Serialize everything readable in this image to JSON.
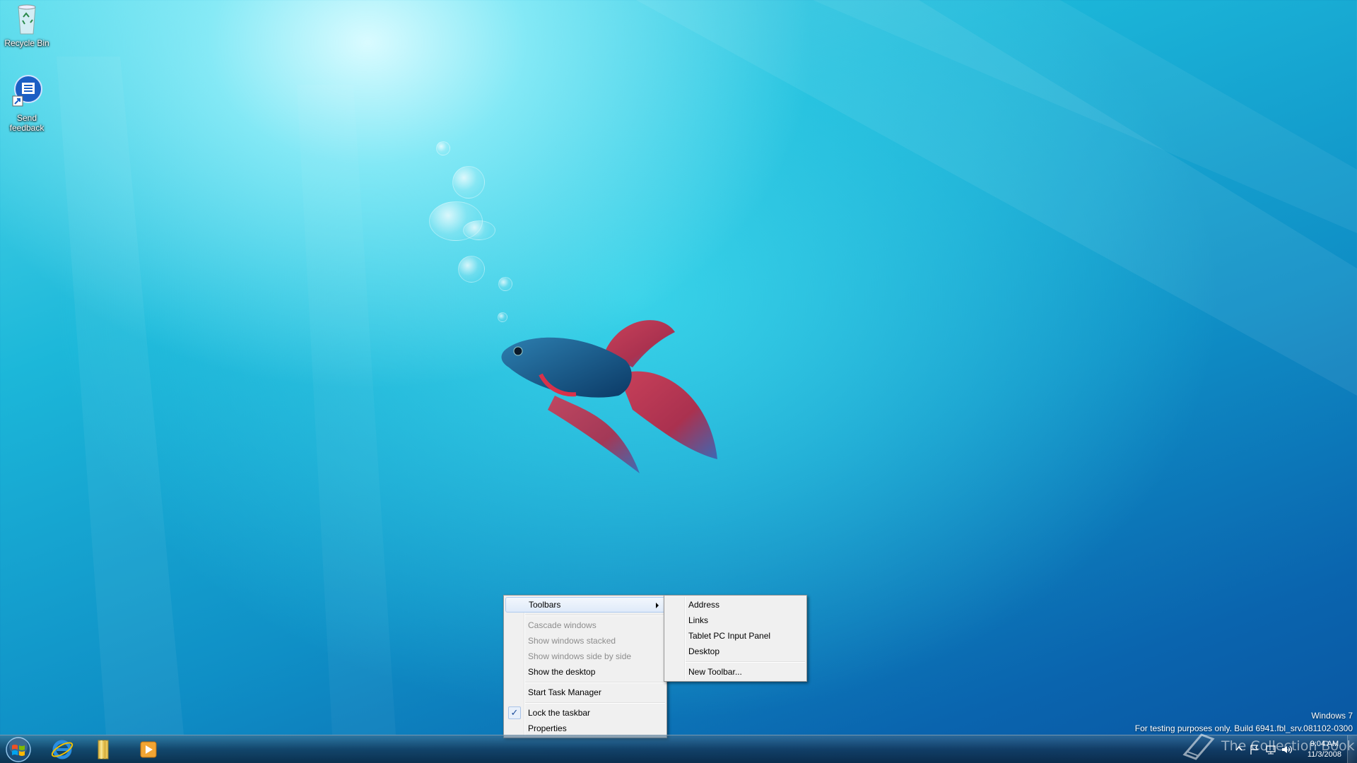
{
  "desktop": {
    "icons": [
      {
        "label": "Recycle Bin",
        "icon": "recycle-bin-icon"
      },
      {
        "label": "Send\nfeedback",
        "icon": "send-feedback-icon"
      }
    ]
  },
  "watermark": {
    "line1": "Windows 7",
    "line2": "For testing purposes only. Build 6941.fbl_srv.081102-0300",
    "overlay": "The Collection Book"
  },
  "taskbar": {
    "start_icon": "windows-orb-icon",
    "pinned": [
      {
        "name": "internet-explorer",
        "icon": "internet-explorer-icon"
      },
      {
        "name": "windows-explorer",
        "icon": "folder-libraries-icon"
      },
      {
        "name": "media-player",
        "icon": "media-player-icon"
      }
    ],
    "clock_time": "9:04 AM",
    "clock_date": "11/3/2008"
  },
  "context_menu": {
    "items": [
      {
        "label": "Toolbars",
        "submenu": true
      },
      {
        "label": "Cascade windows",
        "disabled": true
      },
      {
        "label": "Show windows stacked",
        "disabled": true
      },
      {
        "label": "Show windows side by side",
        "disabled": true
      },
      {
        "label": "Show the desktop"
      },
      {
        "label": "Start Task Manager"
      },
      {
        "label": "Lock the taskbar",
        "checked": true
      },
      {
        "label": "Properties"
      }
    ]
  },
  "toolbars_submenu": {
    "items": [
      {
        "label": "Address"
      },
      {
        "label": "Links"
      },
      {
        "label": "Tablet PC Input Panel"
      },
      {
        "label": "Desktop"
      },
      {
        "label": "New Toolbar..."
      }
    ]
  },
  "colors": {
    "menu_bg": "#f0f0f0",
    "menu_hover": "#dfeaf9",
    "wallpaper_top": "#d9fbff",
    "wallpaper_bottom": "#0a55a0"
  }
}
